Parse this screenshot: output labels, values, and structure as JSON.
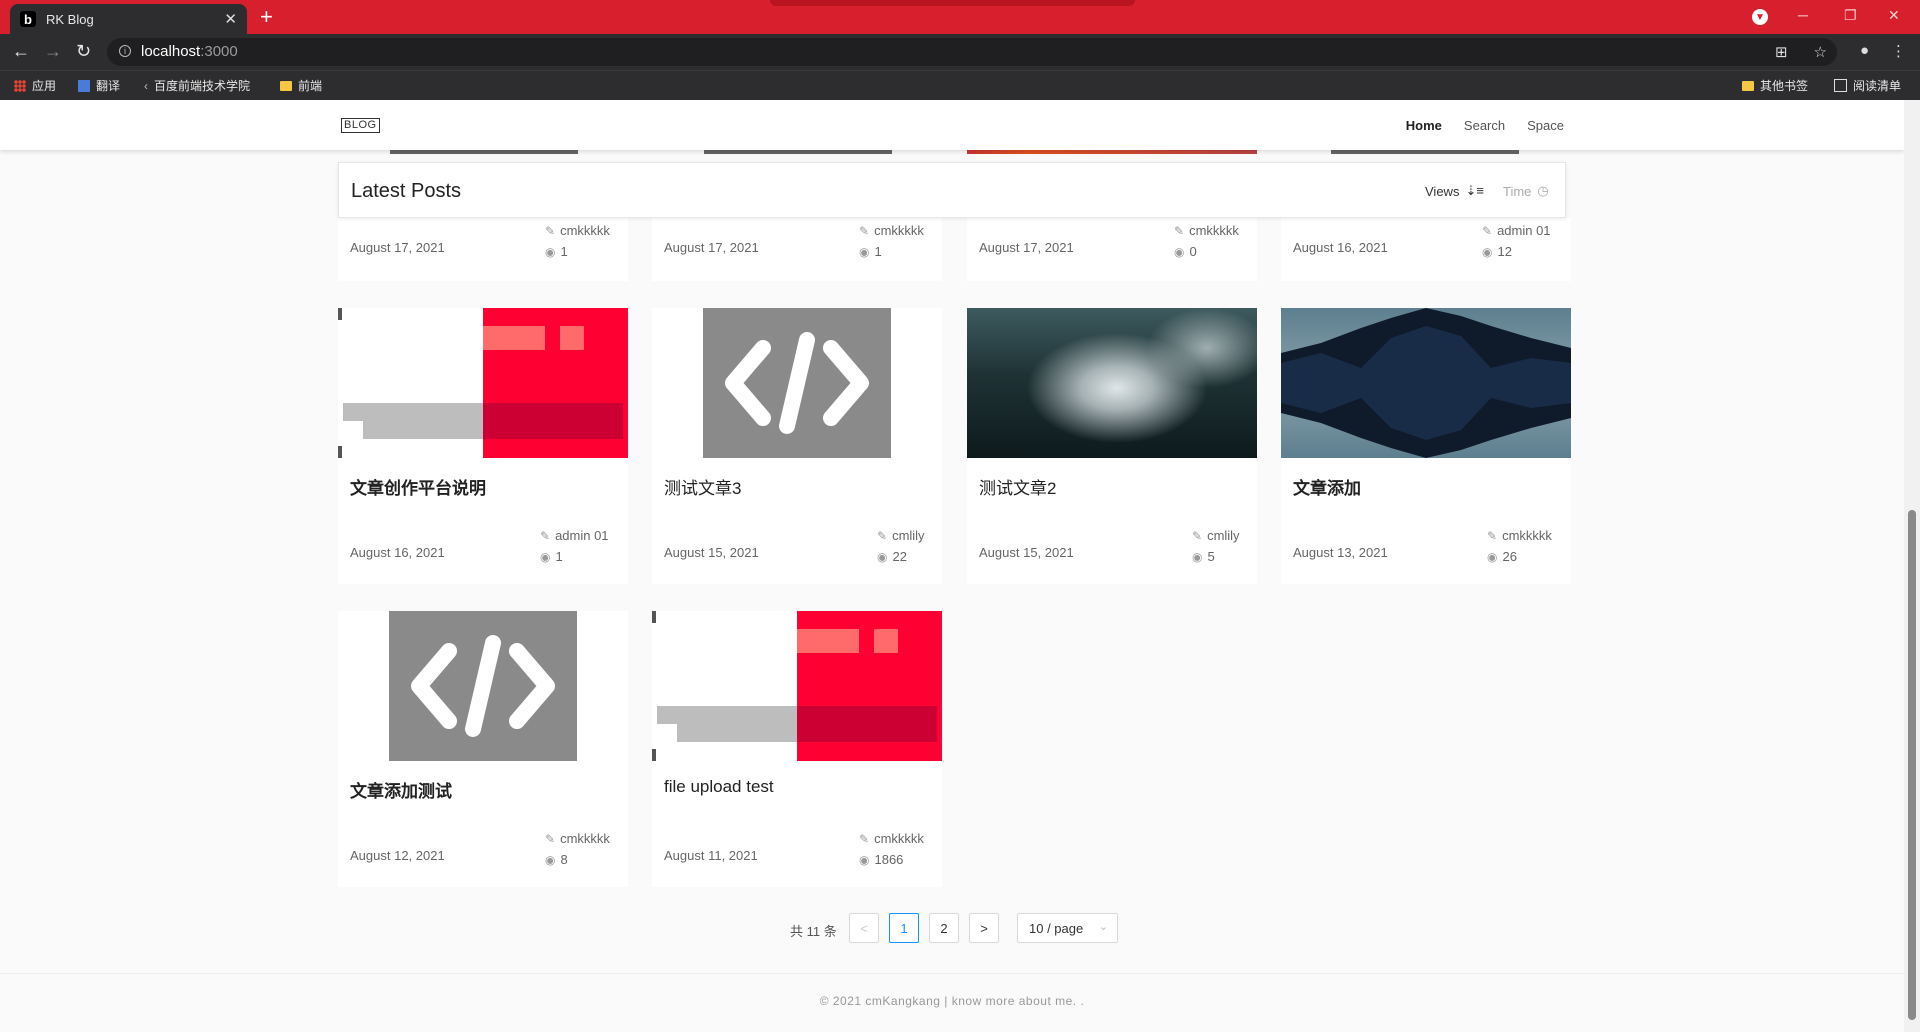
{
  "browser": {
    "tab_title": "RK Blog",
    "tab_favicon": "b",
    "url_host": "localhost",
    "url_port": ":3000",
    "bookmarks": [
      "应用",
      "翻译",
      "百度前端技术学院",
      "前端"
    ],
    "bookmarks_right": [
      "其他书签",
      "阅读清单"
    ]
  },
  "header": {
    "logo": "BLOG",
    "nav": [
      "Home",
      "Search",
      "Space"
    ]
  },
  "posts_bar": {
    "title": "Latest Posts",
    "sort_views": "Views",
    "sort_time": "Time"
  },
  "top_row": [
    {
      "date": "August 17, 2021",
      "author": "cmkkkkk",
      "views": "1"
    },
    {
      "date": "August 17, 2021",
      "author": "cmkkkkk",
      "views": "1"
    },
    {
      "date": "August 17, 2021",
      "author": "cmkkkkk",
      "views": "0"
    },
    {
      "date": "August 16, 2021",
      "author": "admin 01",
      "views": "12"
    }
  ],
  "posts": [
    {
      "title": "文章创作平台说明",
      "date": "August 16, 2021",
      "author": "admin 01",
      "views": "1",
      "image": "red-pattern"
    },
    {
      "title": "测试文章3",
      "date": "August 15, 2021",
      "author": "cmlily",
      "views": "22",
      "image": "code-icon"
    },
    {
      "title": "测试文章2",
      "date": "August 15, 2021",
      "author": "cmlily",
      "views": "5",
      "image": "waterfall-photo"
    },
    {
      "title": "文章添加",
      "date": "August 13, 2021",
      "author": "cmkkkkk",
      "views": "26",
      "image": "mountain-photo"
    },
    {
      "title": "文章添加测试",
      "date": "August 12, 2021",
      "author": "cmkkkkk",
      "views": "8",
      "image": "code-icon"
    },
    {
      "title": "file upload test",
      "date": "August 11, 2021",
      "author": "cmkkkkk",
      "views": "1866",
      "image": "red-pattern"
    }
  ],
  "pagination": {
    "total": "共 11 条",
    "prev": "<",
    "pages": [
      "1",
      "2"
    ],
    "next": ">",
    "page_size": "10 / page"
  },
  "footer": {
    "text": "© 2021 cmKangkang  |  know more about me.  ."
  },
  "colors": {
    "tab_bar": "#d71f2d",
    "accent": "#1890ff",
    "red_image": "#ff0033"
  }
}
